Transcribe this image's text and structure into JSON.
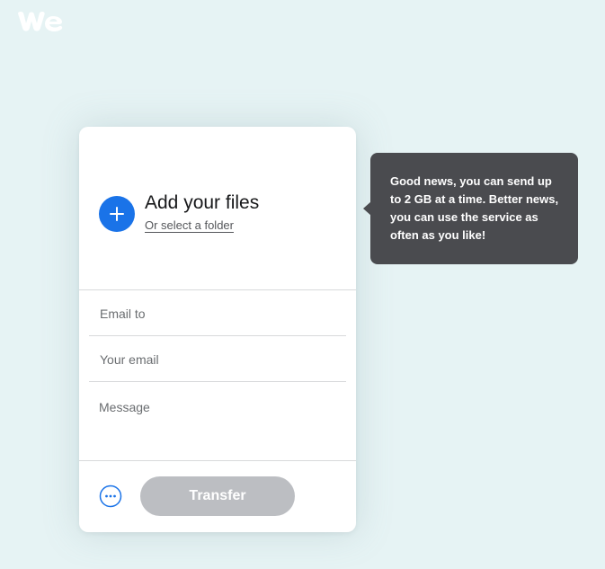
{
  "brand": {
    "logo_icon": "wetransfer-logo-icon"
  },
  "upload": {
    "add_icon": "plus-icon",
    "title": "Add your files",
    "folder_link": "Or select a folder"
  },
  "form": {
    "email_to_placeholder": "Email to",
    "your_email_placeholder": "Your email",
    "message_placeholder": "Message"
  },
  "actions": {
    "more_icon": "more-options-icon",
    "transfer_label": "Transfer"
  },
  "tooltip": {
    "text": "Good news, you can send up to 2 GB at a time. Better news, you can use the service as often as you like!"
  },
  "colors": {
    "background": "#e6f3f4",
    "accent": "#1a73e8",
    "tooltip_bg": "#4a4b4f",
    "transfer_disabled": "#bcbec2"
  }
}
